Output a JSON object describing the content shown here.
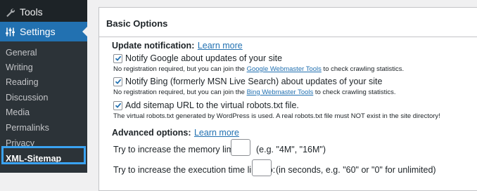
{
  "sidebar": {
    "tools_label": "Tools",
    "settings_label": "Settings",
    "submenu": [
      "General",
      "Writing",
      "Reading",
      "Discussion",
      "Media",
      "Permalinks",
      "Privacy"
    ],
    "xml_sitemap_label": "XML-Sitemap",
    "icons": {
      "tools": "wrench-icon",
      "settings": "settings-sliders-icon"
    }
  },
  "panel": {
    "title": "Basic Options",
    "update_notification": {
      "label": "Update notification:",
      "link": "Learn more",
      "google": {
        "checked": true,
        "label": "Notify Google about updates of your site",
        "desc_before": "No registration required, but you can join the ",
        "desc_link": "Google Webmaster Tools",
        "desc_after": " to check crawling statistics."
      },
      "bing": {
        "checked": true,
        "label": "Notify Bing (formerly MSN Live Search) about updates of your site",
        "desc_before": "No registration required, but you can join the ",
        "desc_link": "Bing Webmaster Tools",
        "desc_after": " to check crawling statistics."
      },
      "robots": {
        "checked": true,
        "label": "Add sitemap URL to the virtual robots.txt file.",
        "desc": "The virtual robots.txt generated by WordPress is used. A real robots.txt file must NOT exist in the site directory!"
      }
    },
    "advanced": {
      "label": "Advanced options:",
      "link": "Learn more",
      "memory_label": "Try to increase the memory limit to:",
      "memory_value": "",
      "memory_hint": "(e.g. \"4M\", \"16M\")",
      "time_label": "Try to increase the execution time limit to:",
      "time_value": "",
      "time_hint": "(in seconds, e.g. \"60\" or \"0\" for unlimited)"
    }
  },
  "colors": {
    "sidebar_bg": "#1d2327",
    "submenu_bg": "#2c3338",
    "active_blue": "#2271b1",
    "highlight_outline": "#3aa3f2",
    "link": "#2271b1"
  }
}
